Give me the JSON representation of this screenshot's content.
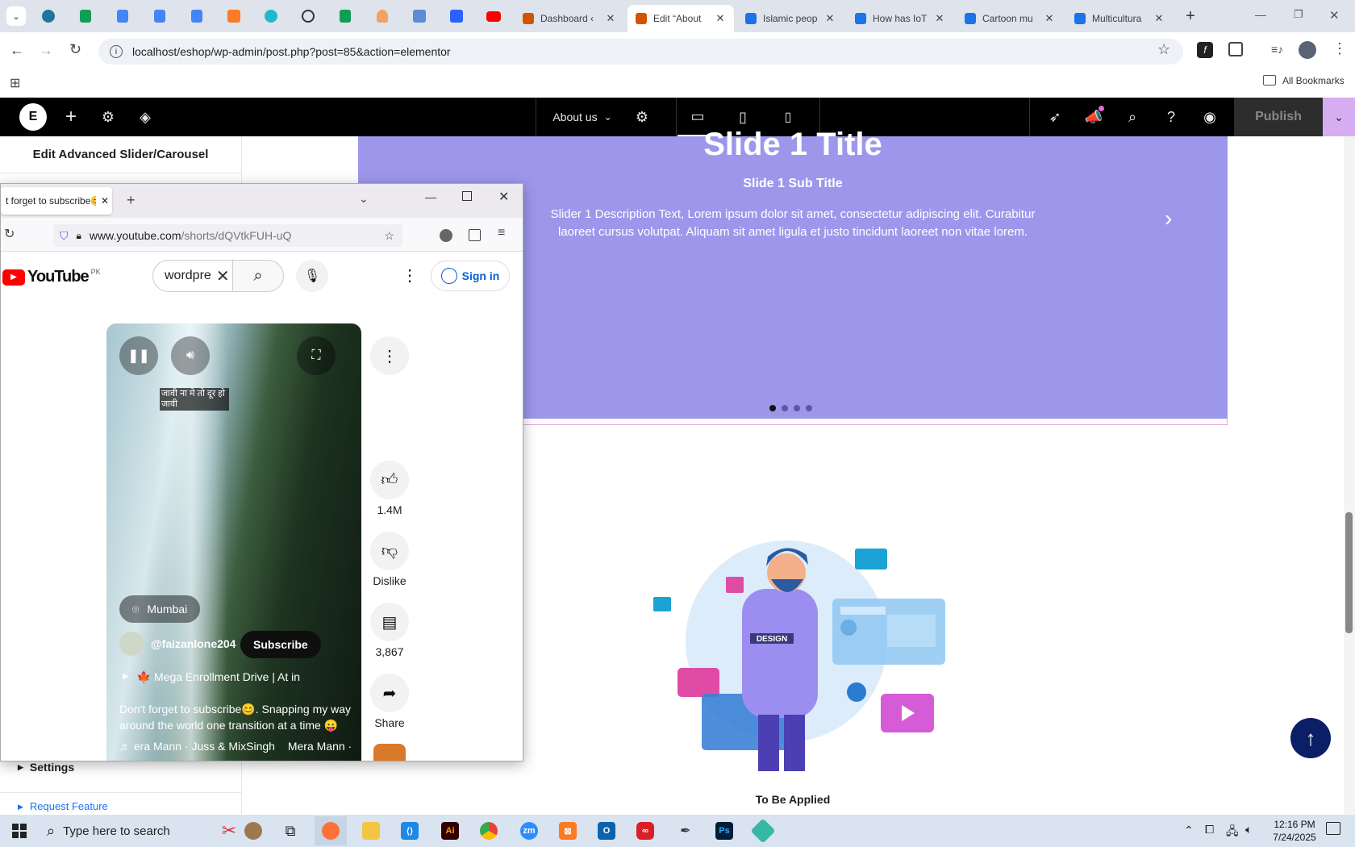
{
  "browser": {
    "tabs": [
      {
        "label": "Dashboard ‹",
        "color": "#d35400"
      },
      {
        "label": "Edit “About",
        "color": "#d35400"
      },
      {
        "label": "Islamic peop",
        "color": "#1a73e8"
      },
      {
        "label": "How has IoT",
        "color": "#1a73e8"
      },
      {
        "label": "Cartoon mu",
        "color": "#1a73e8"
      },
      {
        "label": "Multicultura",
        "color": "#1a73e8"
      }
    ],
    "url": "localhost/eshop/wp-admin/post.php?post=85&action=elementor",
    "all_bookmarks": "All Bookmarks"
  },
  "elementor": {
    "page_name": "About us",
    "publish_label": "Publish",
    "panel_title": "Edit Advanced Slider/Carousel",
    "settings_label": "Settings",
    "request_feature_label": "Request Feature"
  },
  "slider": {
    "title": "Slide 1 Title",
    "subtitle": "Slide 1 Sub Title",
    "description": "Slider 1 Description Text, Lorem ipsum dolor sit amet, consectetur adipiscing elit. Curabitur laoreet cursus volutpat. Aliquam sit amet ligula et justo tincidunt laoreet non vitae lorem.",
    "active_dot": 1,
    "dot_count": 4
  },
  "illustration": {
    "shirt_text": "DESIGN",
    "caption": "To Be Applied"
  },
  "popup": {
    "tab_label": "t forget to subscribe😊",
    "url_host": "www.youtube.com",
    "url_path": "/shorts/dQVtkFUH-uQ",
    "youtube_logo": "YouTube",
    "country": "PK",
    "search_value": "wordpre",
    "sign_in": "Sign in",
    "video_caption": "जावी ना मे तो दूर हो जावी",
    "location": "Mumbai",
    "channel": "@faizanlone204",
    "subscribe": "Subscribe",
    "playlist": "🍁 Mega Enrollment Drive | At in",
    "description": "Don't forget to subscribe😊. Snapping my way around the world one transition at a time 😛",
    "music": "♬ era Mann · Juss & MixSingh",
    "music2": "Mera Mann ·",
    "likes": "1.4M",
    "dislike": "Dislike",
    "comments": "3,867",
    "share": "Share"
  },
  "taskbar": {
    "search_placeholder": "Type here to search",
    "time": "12:16 PM",
    "date": "7/24/2025"
  }
}
